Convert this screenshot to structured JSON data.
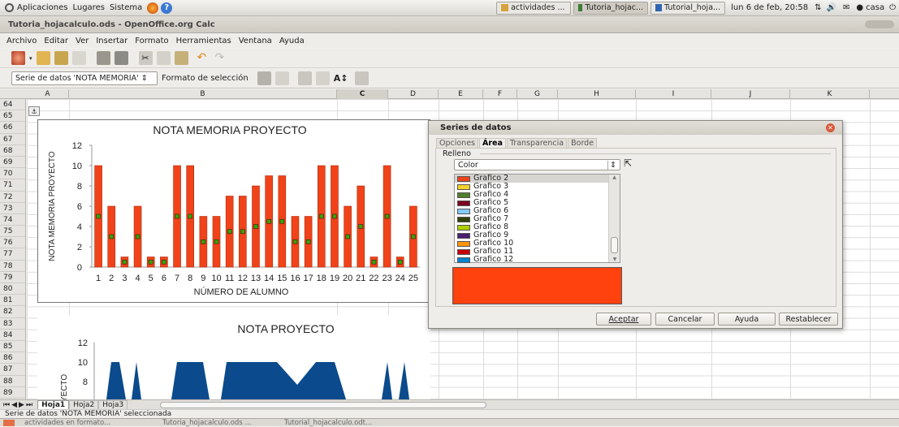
{
  "panel": {
    "menus": [
      "Aplicaciones",
      "Lugares",
      "Sistema"
    ],
    "tasks": [
      "actividades ...",
      "Tutoria_hojac...",
      "Tutorial_hoja..."
    ],
    "clock": "lun 6 de feb, 20:58",
    "user": "casa"
  },
  "window": {
    "title": "Tutoria_hojacalculo.ods - OpenOffice.org Calc"
  },
  "menubar": [
    "Archivo",
    "Editar",
    "Ver",
    "Insertar",
    "Formato",
    "Herramientas",
    "Ventana",
    "Ayuda"
  ],
  "toolbar2": {
    "selector_value": "Serie de datos 'NOTA MEMORIA'",
    "format_selection": "Formato de selección"
  },
  "columns": [
    "A",
    "B",
    "C",
    "D",
    "E",
    "F",
    "G",
    "H",
    "I",
    "J",
    "K"
  ],
  "rows": [
    "64",
    "65",
    "66",
    "67",
    "68",
    "69",
    "70",
    "71",
    "72",
    "73",
    "74",
    "75",
    "76",
    "77",
    "78",
    "79",
    "80",
    "81",
    "82",
    "83",
    "84",
    "85",
    "86",
    "87",
    "88",
    "89"
  ],
  "chart_data": [
    {
      "type": "bar",
      "title": "NOTA MEMORIA PROYECTO",
      "xlabel": "NÚMERO DE ALUMNO",
      "ylabel": "NOTA MEMORIA PROYECTO",
      "ylim": [
        0,
        12
      ],
      "yticks": [
        0,
        2,
        4,
        6,
        8,
        10,
        12
      ],
      "categories": [
        "1",
        "2",
        "3",
        "4",
        "5",
        "6",
        "7",
        "8",
        "9",
        "10",
        "11",
        "12",
        "13",
        "14",
        "15",
        "16",
        "17",
        "18",
        "19",
        "20",
        "21",
        "22",
        "23",
        "24",
        "25"
      ],
      "series": [
        {
          "values": [
            10,
            6,
            1,
            6,
            1,
            1,
            10,
            10,
            5,
            5,
            7,
            7,
            8,
            9,
            9,
            5,
            5,
            10,
            10,
            6,
            8,
            1,
            10,
            1,
            6
          ]
        },
        {
          "values": [
            5,
            3,
            0.5,
            3,
            0.5,
            0.5,
            5,
            5,
            2.5,
            2.5,
            3.5,
            3.5,
            4,
            4.5,
            4.5,
            2.5,
            2.5,
            5,
            5,
            3,
            4,
            0.5,
            5,
            0.5,
            3
          ]
        }
      ],
      "colors": [
        "#f0431a",
        "#3aa300"
      ]
    },
    {
      "type": "area",
      "title": "NOTA PROYECTO",
      "ylabel": "YECTO",
      "yticks": [
        8,
        10,
        12
      ],
      "colors": [
        "#0b4a8c"
      ]
    }
  ],
  "sheet_tabs": [
    "Hoja1",
    "Hoja2",
    "Hoja3"
  ],
  "status": "Serie de datos 'NOTA MEMORIA' seleccionada",
  "taskbar": [
    "actividades en formato...",
    "Tutoria_hojacalculo.ods ...",
    "Tutorial_hojacalculo.odt..."
  ],
  "dialog": {
    "title": "Series de datos",
    "tabs": [
      "Opciones",
      "Área",
      "Transparencia",
      "Borde"
    ],
    "section": "Relleno",
    "fill_type": "Color",
    "colors": [
      {
        "name": "Grafico 2",
        "hex": "#f0431a"
      },
      {
        "name": "Grafico 3",
        "hex": "#f6d12a"
      },
      {
        "name": "Grafico 4",
        "hex": "#4f7f2a"
      },
      {
        "name": "Grafico 5",
        "hex": "#7e0021"
      },
      {
        "name": "Grafico 6",
        "hex": "#83caff"
      },
      {
        "name": "Grafico 7",
        "hex": "#314004"
      },
      {
        "name": "Grafico 8",
        "hex": "#aecf00"
      },
      {
        "name": "Grafico 9",
        "hex": "#4b1f6f"
      },
      {
        "name": "Grafico 10",
        "hex": "#ff950e"
      },
      {
        "name": "Grafico 11",
        "hex": "#c5000b"
      },
      {
        "name": "Grafico 12",
        "hex": "#0084d1"
      }
    ],
    "preview_color": "#ff420e",
    "buttons": [
      "Aceptar",
      "Cancelar",
      "Ayuda",
      "Restablecer"
    ]
  }
}
